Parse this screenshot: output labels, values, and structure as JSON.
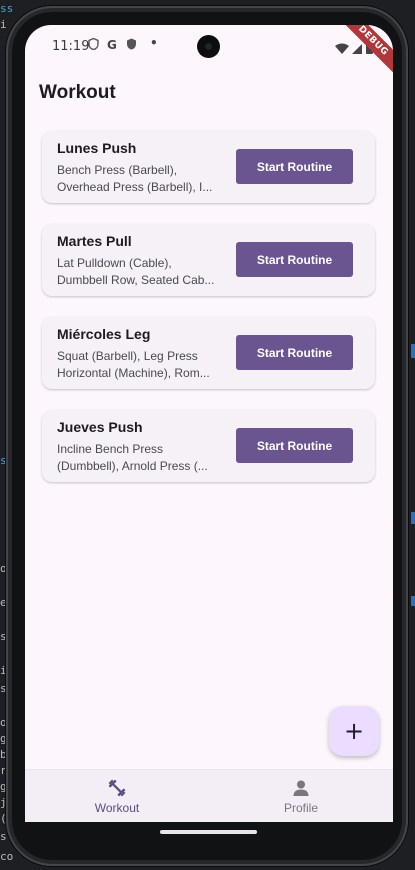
{
  "status_bar": {
    "time": "11:19",
    "icons": [
      "shield-icon",
      "google-icon",
      "shield-check-icon",
      "dot-icon",
      "wifi-icon",
      "signal-icon",
      "battery-icon"
    ],
    "google_glyph": "G",
    "debug_banner": "DEBUG"
  },
  "page": {
    "title": "Workout"
  },
  "routines": [
    {
      "name": "Lunes Push",
      "exercises": "Bench Press (Barbell), Overhead Press (Barbell), I...",
      "button_label": "Start Routine"
    },
    {
      "name": "Martes Pull",
      "exercises": "Lat Pulldown (Cable), Dumbbell Row, Seated Cab...",
      "button_label": "Start Routine"
    },
    {
      "name": "Miércoles Leg",
      "exercises": "Squat (Barbell), Leg Press Horizontal (Machine), Rom...",
      "button_label": "Start Routine"
    },
    {
      "name": "Jueves Push",
      "exercises": "Incline Bench Press (Dumbbell), Arnold Press (...",
      "button_label": "Start Routine"
    }
  ],
  "fab": {
    "icon": "plus-icon",
    "glyph": "+"
  },
  "bottom_nav": {
    "items": [
      {
        "label": "Workout",
        "icon": "dumbbell-icon",
        "active": true
      },
      {
        "label": "Profile",
        "icon": "person-icon",
        "active": false
      }
    ]
  },
  "colors": {
    "background": "#fdf7fd",
    "card": "#f6f1f7",
    "primary_button": "#6a5591",
    "fab": "#eaddff",
    "nav_active": "#5b4d7f",
    "nav_inactive": "#7a757f",
    "debug_banner": "#b0373a"
  }
}
